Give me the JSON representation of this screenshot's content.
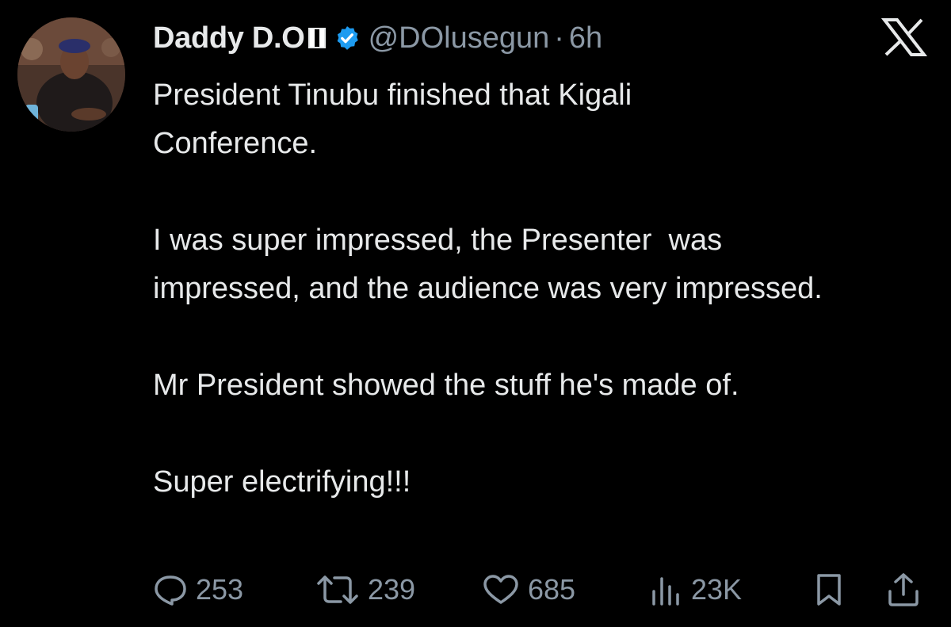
{
  "tweet": {
    "display_name": "Daddy D.O",
    "flag_icon": "nigeria-flag-icon",
    "verified_icon": "verified-badge-icon",
    "verified_color": "#1d9bf0",
    "handle": "@DOlusegun",
    "separator": "·",
    "time": "6h",
    "paragraphs": [
      "President Tinubu finished that Kigali Conference.",
      "I was super impressed, the Presenter  was impressed, and the audience was very impressed.",
      "Mr President showed the stuff he's made of.",
      "Super electrifying!!!"
    ],
    "stats": {
      "replies": "253",
      "retweets": "239",
      "likes": "685",
      "views": "23K"
    }
  },
  "brand": {
    "logo_icon": "x-logo-icon"
  },
  "colors": {
    "background": "#000000",
    "text": "#e7e9ea",
    "secondary": "#8b98a5"
  }
}
